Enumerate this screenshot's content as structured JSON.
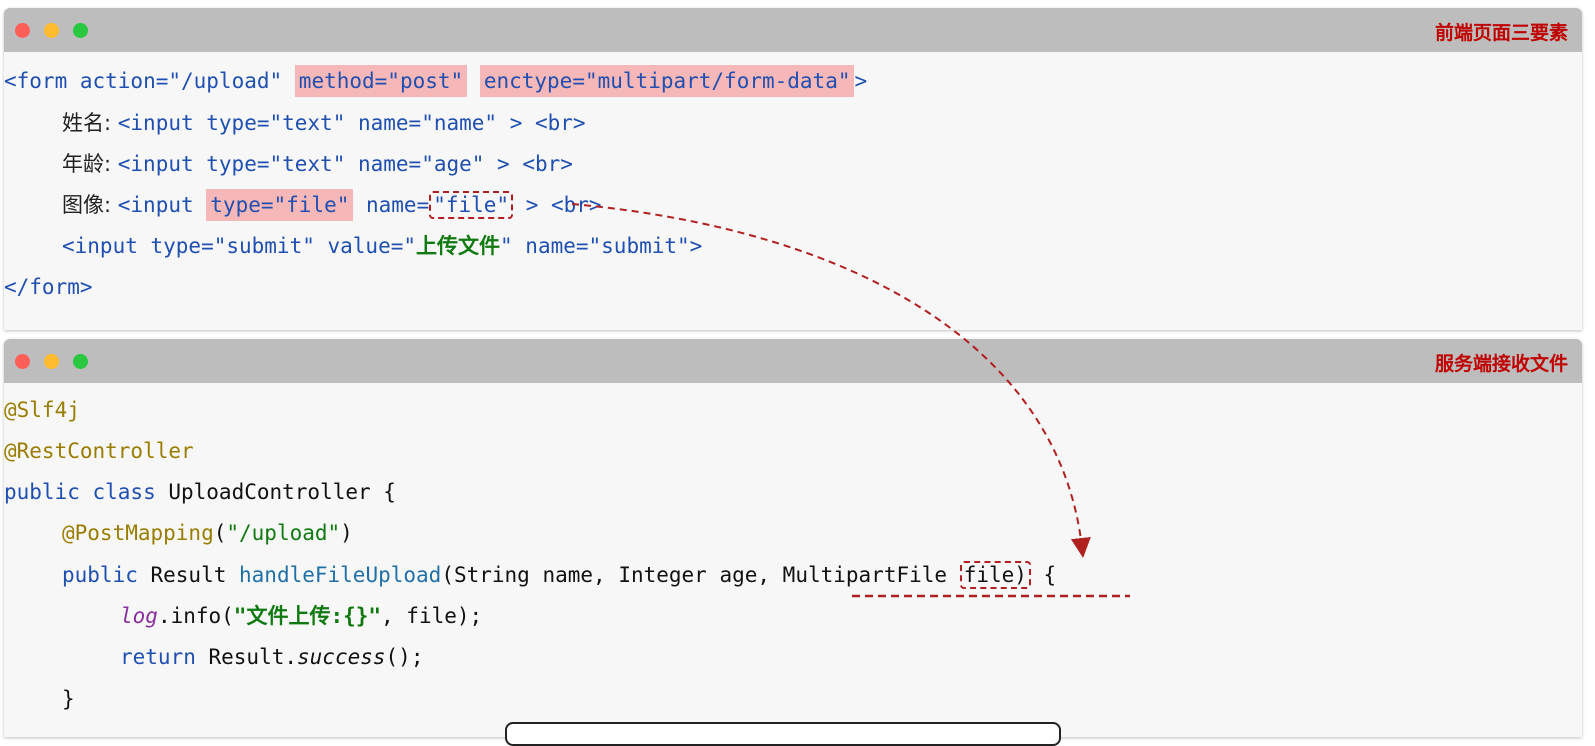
{
  "panel_top": {
    "title": "前端页面三要素",
    "lines": {
      "l1": {
        "t1": "<form action=\"/upload\" ",
        "hl1": "method=\"post\"",
        "sp": " ",
        "hl2": "enctype=\"multipart/form-data\"",
        "t2": ">"
      },
      "l2": {
        "label": "姓名: ",
        "code": "<input type=\"text\" name=\"name\" > <br>"
      },
      "l3": {
        "label": "年龄: ",
        "code": "<input type=\"text\" name=\"age\" > <br>"
      },
      "l4": {
        "label": "图像: ",
        "t1": "<input ",
        "hl": "type=\"file\"",
        "t2": " name=",
        "box": "\"file\"",
        "t3": " > <br>"
      },
      "l5": {
        "t1": "<input type=\"submit\" value=\"",
        "cn": "上传文件",
        "t2": "\" name=\"submit\">"
      },
      "l6": {
        "t1": "</form>"
      }
    }
  },
  "panel_bottom": {
    "title": "服务端接收文件",
    "lines": {
      "l1": "@Slf4j",
      "l2": "@RestController",
      "l3": {
        "k1": "public class",
        "t": " UploadController {"
      },
      "l4": {
        "ann": "@PostMapping",
        "t1": "(",
        "s": "\"/upload\"",
        "t2": ")"
      },
      "l5": {
        "k": "public",
        "t1": " Result ",
        "m": "handleFileUpload",
        "t2": "(String name, Integer age, MultipartFile ",
        "box": "file)",
        "t3": " {"
      },
      "l6": {
        "log": "log",
        "t1": ".info(",
        "s": "\"文件上传:{}\"",
        "t2": ", file);"
      },
      "l7": {
        "k": "return",
        "t1": " Result.",
        "it": "success",
        "t2": "();"
      },
      "l8": "}"
    }
  },
  "colors": {
    "accent": "#c00000",
    "highlight": "#f5b7b7",
    "arrow": "#b02020"
  }
}
